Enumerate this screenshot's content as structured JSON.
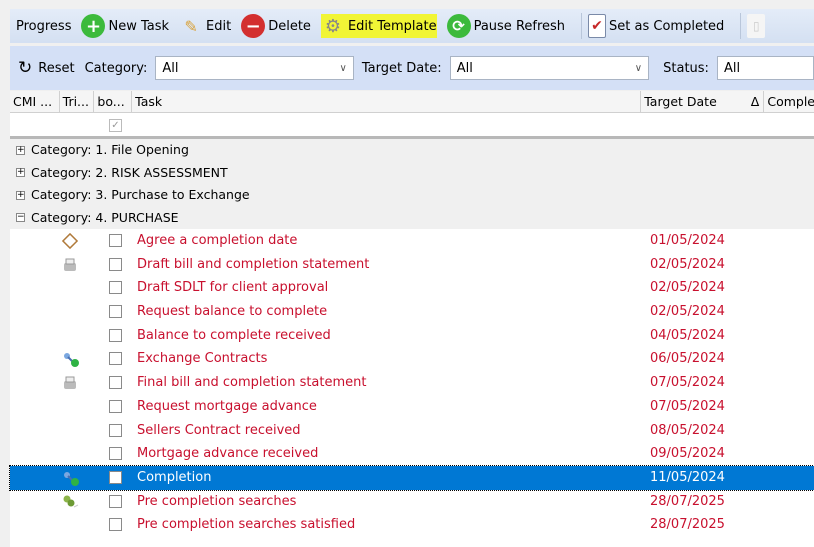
{
  "toolbar": {
    "progress": "Progress",
    "new_task": "New Task",
    "edit": "Edit",
    "delete": "Delete",
    "edit_template": "Edit Template",
    "pause_refresh": "Pause Refresh",
    "set_completed": "Set as Completed"
  },
  "filters": {
    "reset": "Reset",
    "category_label": "Category:",
    "category_value": "All",
    "target_date_label": "Target Date:",
    "target_date_value": "All",
    "status_label": "Status:",
    "status_value": "All"
  },
  "columns": [
    "CMI ...",
    "Tri...",
    "bo...",
    "Task",
    "Target Date",
    "Δ",
    "Comple"
  ],
  "groups": [
    "Category: 1. File Opening",
    "Category: 2. RISK ASSESSMENT",
    "Category: 3. Purchase to Exchange",
    "Category: 4. PURCHASE"
  ],
  "tasks": [
    {
      "task": "Agree a completion date",
      "date": "01/05/2024",
      "icon": "scroll"
    },
    {
      "task": "Draft bill and completion statement",
      "date": "02/05/2024",
      "icon": "printer"
    },
    {
      "task": "Draft SDLT for client approval",
      "date": "02/05/2024",
      "icon": ""
    },
    {
      "task": "Request balance to complete",
      "date": "02/05/2024",
      "icon": ""
    },
    {
      "task": "Balance to complete received",
      "date": "04/05/2024",
      "icon": ""
    },
    {
      "task": "Exchange Contracts",
      "date": "06/05/2024",
      "icon": "key-check"
    },
    {
      "task": "Final bill and completion statement",
      "date": "07/05/2024",
      "icon": "printer"
    },
    {
      "task": "Request mortgage advance",
      "date": "07/05/2024",
      "icon": ""
    },
    {
      "task": "Sellers Contract received",
      "date": "08/05/2024",
      "icon": ""
    },
    {
      "task": "Mortgage advance received",
      "date": "09/05/2024",
      "icon": ""
    },
    {
      "task": "Completion",
      "date": "11/05/2024",
      "icon": "key-check",
      "selected": true
    },
    {
      "task": "Pre completion searches",
      "date": "28/07/2025",
      "icon": "search"
    },
    {
      "task": "Pre completion searches satisfied",
      "date": "28/07/2025",
      "icon": ""
    }
  ]
}
